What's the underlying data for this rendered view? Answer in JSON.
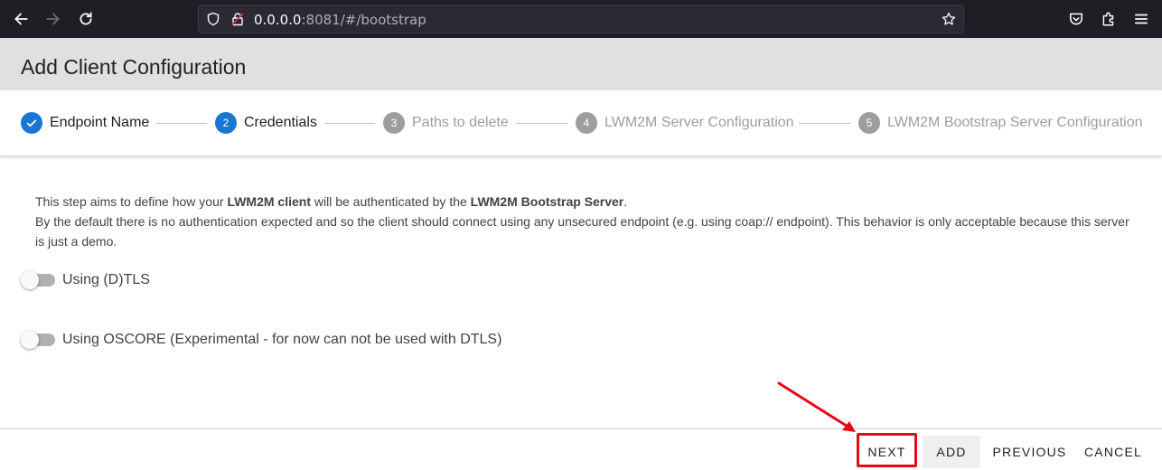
{
  "browser": {
    "url_host": "0.0.0.0",
    "url_rest": ":8081/#/bootstrap"
  },
  "page": {
    "title": "Add Client Configuration"
  },
  "stepper": {
    "steps": [
      {
        "number": "",
        "label": "Endpoint Name",
        "state": "completed"
      },
      {
        "number": "2",
        "label": "Credentials",
        "state": "active"
      },
      {
        "number": "3",
        "label": "Paths to delete",
        "state": "inactive"
      },
      {
        "number": "4",
        "label": "LWM2M Server Configuration",
        "state": "inactive"
      },
      {
        "number": "5",
        "label": "LWM2M Bootstrap Server Configuration",
        "state": "inactive"
      }
    ]
  },
  "content": {
    "line1_a": "This step aims to define how your ",
    "line1_b": "LWM2M client",
    "line1_c": " will be authenticated by the ",
    "line1_d": "LWM2M Bootstrap Server",
    "line1_e": ".",
    "line2": "By the default there is no authentication expected and so the client should connect using any unsecured endpoint (e.g. using coap:// endpoint). This behavior is only acceptable because this server is just a demo.",
    "toggle_dtls": {
      "label": "Using (D)TLS",
      "checked": false
    },
    "toggle_oscore": {
      "label": "Using OSCORE (Experimental - for now can not be used with DTLS)",
      "checked": false
    }
  },
  "footer": {
    "next_label": "NEXT",
    "add_label": "ADD",
    "previous_label": "PREVIOUS",
    "cancel_label": "CANCEL"
  },
  "colors": {
    "accent": "#1976d2",
    "annotation": "#e50914"
  }
}
